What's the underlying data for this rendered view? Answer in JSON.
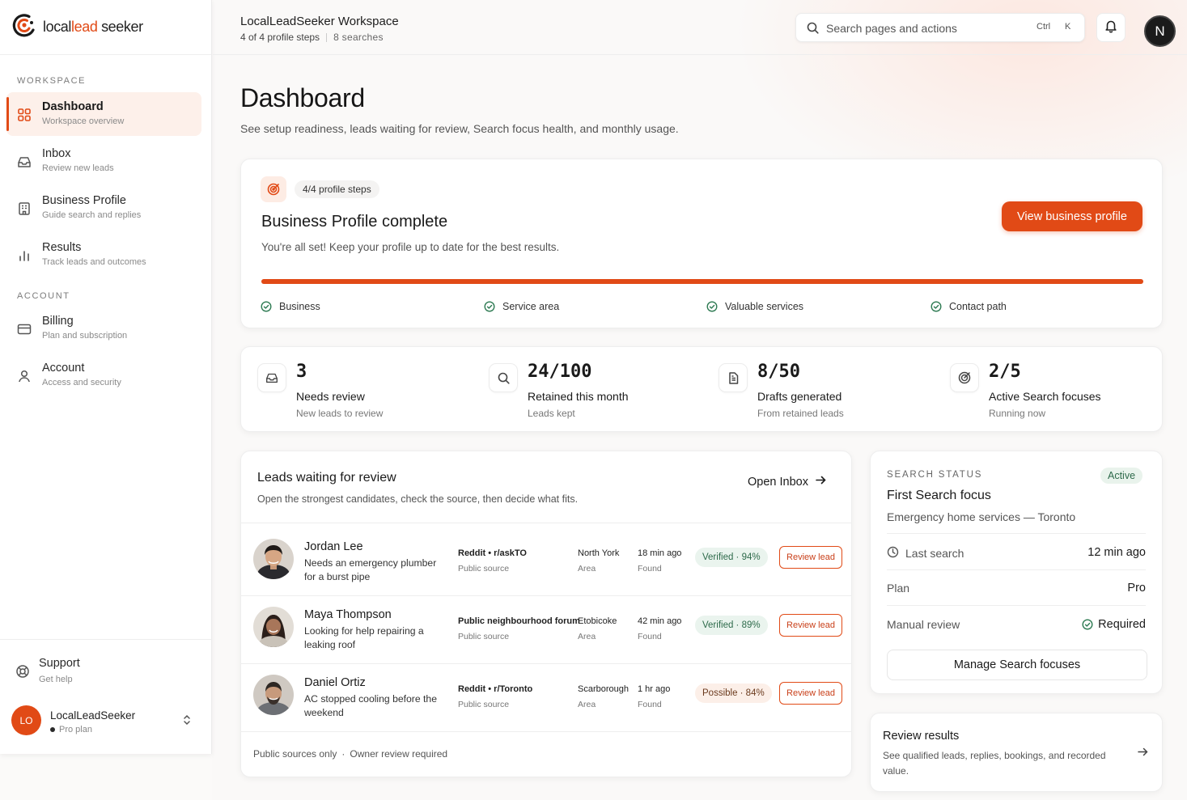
{
  "app": {
    "brand_pre": "local",
    "brand_lead": "lead",
    "brand_post": " seeker"
  },
  "sidebar": {
    "workspace_label": "WORKSPACE",
    "account_label": "ACCOUNT",
    "items": [
      {
        "label": "Dashboard",
        "sub": "Workspace overview",
        "icon": "grid-icon",
        "active": true
      },
      {
        "label": "Inbox",
        "sub": "Review new leads",
        "icon": "inbox-icon"
      },
      {
        "label": "Business Profile",
        "sub": "Guide search and replies",
        "icon": "building-icon"
      },
      {
        "label": "Results",
        "sub": "Track leads and outcomes",
        "icon": "bar-chart-icon"
      },
      {
        "label": "Billing",
        "sub": "Plan and subscription",
        "icon": "credit-card-icon"
      },
      {
        "label": "Account",
        "sub": "Access and security",
        "icon": "user-icon"
      }
    ],
    "support": {
      "label": "Support",
      "sub": "Get help"
    },
    "user": {
      "initials": "LO",
      "name": "LocalLeadSeeker",
      "plan": "Pro plan"
    }
  },
  "header": {
    "title": "LocalLeadSeeker Workspace",
    "steps": "4 of 4 profile steps",
    "searches": "8  searches",
    "search_placeholder": "Search pages and actions",
    "shortcut_ctrl": "Ctrl",
    "shortcut_key": "K",
    "avatar": "N"
  },
  "page": {
    "title": "Dashboard",
    "subtitle": "See setup readiness, leads waiting for review, Search focus health, and monthly usage."
  },
  "profile": {
    "pill": "4/4 profile steps",
    "title": "Business Profile complete",
    "subtitle": "You're all set! Keep your profile up to date for the best results.",
    "button": "View business profile",
    "progress": 1.0,
    "steps": [
      "Business",
      "Service area",
      "Valuable services",
      "Contact path"
    ],
    "accent": "#e14a16"
  },
  "stats": [
    {
      "value": "3",
      "label": "Needs review",
      "sub": "New leads to review",
      "icon": "inbox-icon"
    },
    {
      "value": "24/100",
      "label": "Retained this month",
      "sub": "Leads kept",
      "icon": "search-icon"
    },
    {
      "value": "8/50",
      "label": "Drafts generated",
      "sub": "From retained leads",
      "icon": "document-icon"
    },
    {
      "value": "2/5",
      "label": "Active Search focuses",
      "sub": "Running now",
      "icon": "target-icon"
    }
  ],
  "leads": {
    "title": "Leads waiting for review",
    "subtitle": "Open the strongest candidates, check the source, then decide what fits.",
    "open_inbox": "Open Inbox",
    "review_label": "Review lead",
    "source_sub": "Public source",
    "area_sub": "Area",
    "time_sub": "Found",
    "rows": [
      {
        "name": "Jordan Lee",
        "desc": "Needs an emergency plumber for a burst pipe",
        "source": "Reddit • r/askTO",
        "area": "North York",
        "time": "18 min ago",
        "status": "Verified · 94%",
        "kind": "verified"
      },
      {
        "name": "Maya Thompson",
        "desc": "Looking for help repairing a leaking roof",
        "source": "Public neighbourhood forum",
        "area": "Etobicoke",
        "time": "42 min ago",
        "status": "Verified · 89%",
        "kind": "verified"
      },
      {
        "name": "Daniel Ortiz",
        "desc": "AC stopped cooling before the weekend",
        "source": "Reddit • r/Toronto",
        "area": "Scarborough",
        "time": "1 hr ago",
        "status": "Possible · 84%",
        "kind": "possible"
      }
    ],
    "footer_a": "Public sources only",
    "footer_b": "Owner review required"
  },
  "search_status": {
    "label": "SEARCH STATUS",
    "badge": "Active",
    "title": "First Search focus",
    "subtitle": "Emergency home services — Toronto",
    "last_search_label": "Last search",
    "last_search_value": "12 min ago",
    "plan_label": "Plan",
    "plan_value": "Pro",
    "manual_label": "Manual review",
    "manual_value": "Required",
    "button": "Manage Search focuses"
  },
  "review_results": {
    "title": "Review results",
    "subtitle": "See qualified leads, replies, bookings, and recorded value."
  }
}
